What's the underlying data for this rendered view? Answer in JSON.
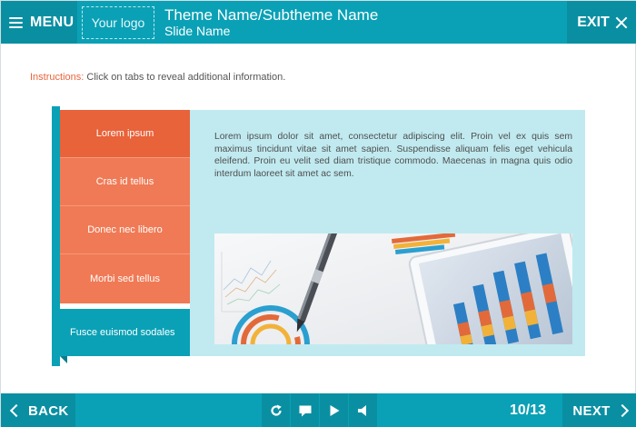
{
  "header": {
    "menu_label": "MENU",
    "logo_text": "Your logo",
    "theme_name": "Theme Name/Subtheme Name",
    "slide_name": "Slide Name",
    "exit_label": "EXIT"
  },
  "instructions": {
    "lead": "Instructions:",
    "text": " Click on tabs to reveal additional information."
  },
  "tabs": [
    {
      "label": "Lorem ipsum"
    },
    {
      "label": "Cras id tellus"
    },
    {
      "label": "Donec nec libero"
    },
    {
      "label": "Morbi sed tellus"
    },
    {
      "label": "Fusce euismod sodales"
    }
  ],
  "content": {
    "body": "Lorem ipsum dolor sit amet, consectetur adipiscing elit. Proin vel ex quis sem maximus tincidunt vitae sit amet sapien. Suspendisse aliquam felis eget vehicula eleifend. Proin eu velit sed diam tristique commodo. Maecenas in magna quis odio interdum laoreet sit amet ac sem."
  },
  "footer": {
    "back_label": "BACK",
    "next_label": "NEXT",
    "page_counter": "10/13",
    "controls": [
      "replay-icon",
      "comment-icon",
      "play-icon",
      "volume-icon"
    ]
  },
  "colors": {
    "teal": "#0aa1b6",
    "teal_dark": "#0a8fa2",
    "orange": "#f07a55",
    "orange_active": "#e8623a",
    "panel": "#c0eaf0"
  }
}
